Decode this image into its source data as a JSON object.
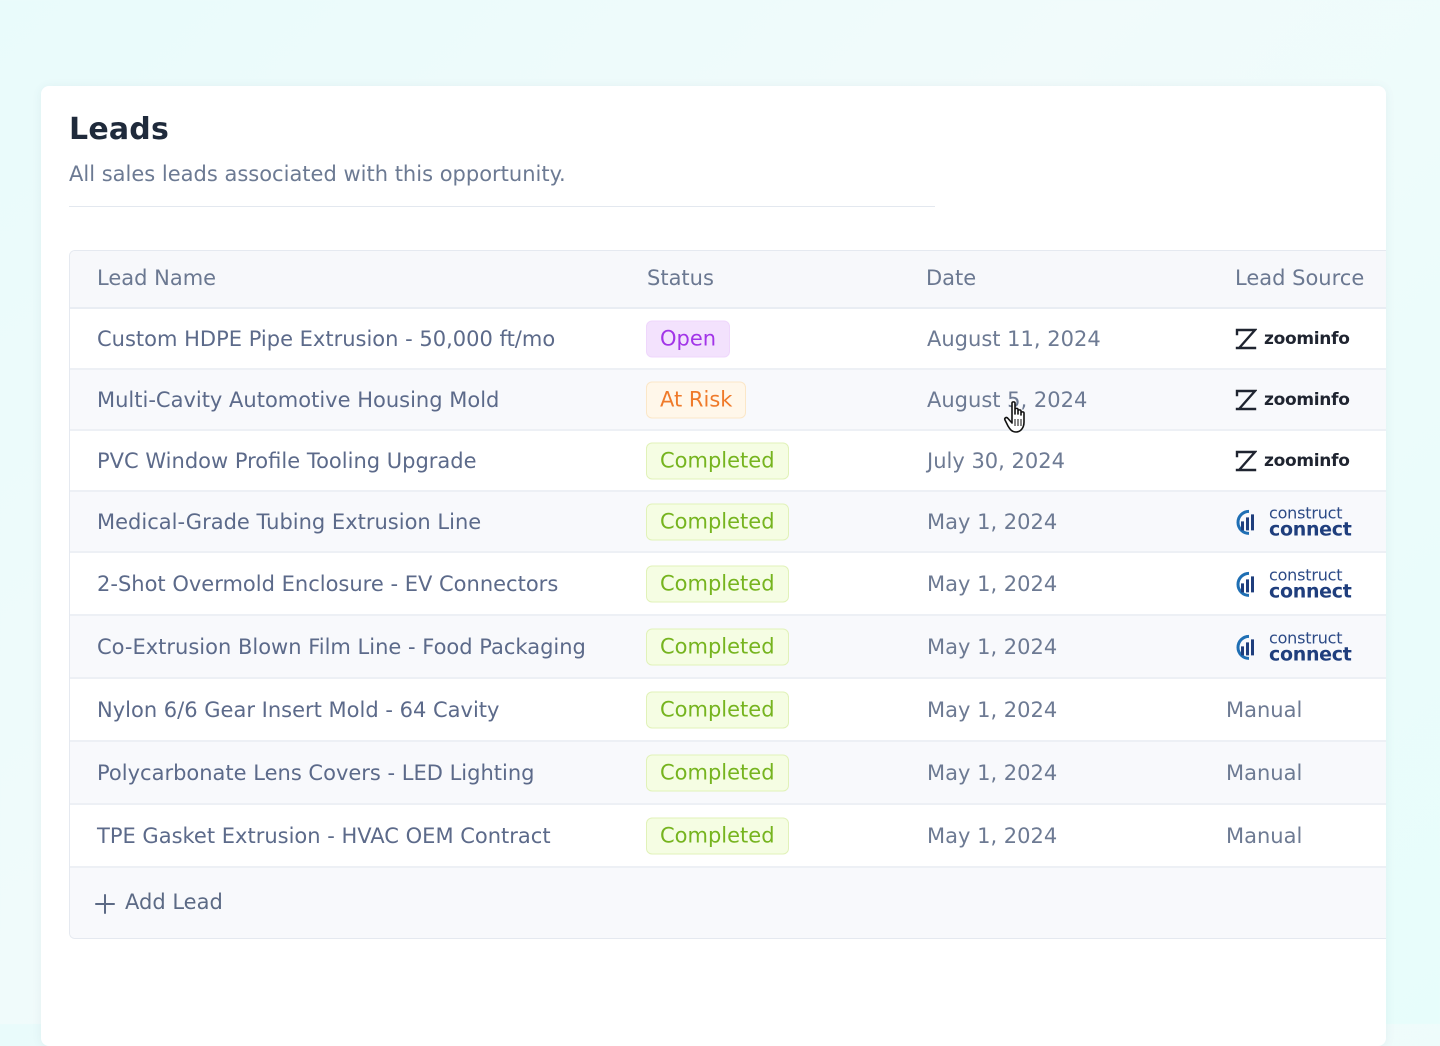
{
  "card": {
    "title": "Leads",
    "subtitle": "All sales leads associated with this opportunity."
  },
  "table": {
    "columns": [
      "Lead Name",
      "Status",
      "Date",
      "Lead Source"
    ],
    "rows": [
      {
        "name": "Custom HDPE Pipe Extrusion - 50,000 ft/mo",
        "status": "Open",
        "status_kind": "open",
        "date": "August 11, 2024",
        "source": "zoominfo",
        "source_kind": "zoominfo"
      },
      {
        "name": "Multi-Cavity Automotive Housing Mold",
        "status": "At Risk",
        "status_kind": "risk",
        "date": "August 5, 2024",
        "source": "zoominfo",
        "source_kind": "zoominfo"
      },
      {
        "name": "PVC Window Profile Tooling Upgrade",
        "status": "Completed",
        "status_kind": "done",
        "date": "July 30, 2024",
        "source": "zoominfo",
        "source_kind": "zoominfo"
      },
      {
        "name": "Medical-Grade Tubing Extrusion Line",
        "status": "Completed",
        "status_kind": "done",
        "date": "May 1, 2024",
        "source": "construct connect",
        "source_kind": "constructconnect"
      },
      {
        "name": "2-Shot Overmold Enclosure - EV Connectors",
        "status": "Completed",
        "status_kind": "done",
        "date": "May 1, 2024",
        "source": "construct connect",
        "source_kind": "constructconnect"
      },
      {
        "name": "Co-Extrusion Blown Film Line - Food Packaging",
        "status": "Completed",
        "status_kind": "done",
        "date": "May 1, 2024",
        "source": "construct connect",
        "source_kind": "constructconnect"
      },
      {
        "name": "Nylon 6/6 Gear Insert Mold - 64 Cavity",
        "status": "Completed",
        "status_kind": "done",
        "date": "May 1, 2024",
        "source": "Manual",
        "source_kind": "manual"
      },
      {
        "name": "Polycarbonate Lens Covers - LED Lighting",
        "status": "Completed",
        "status_kind": "done",
        "date": "May 1, 2024",
        "source": "Manual",
        "source_kind": "manual"
      },
      {
        "name": "TPE Gasket Extrusion - HVAC OEM Contract",
        "status": "Completed",
        "status_kind": "done",
        "date": "May 1, 2024",
        "source": "Manual",
        "source_kind": "manual"
      }
    ],
    "add_label": "Add Lead"
  },
  "logos": {
    "zoominfo": {
      "top": "",
      "label": "zoominfo"
    },
    "constructconnect": {
      "top": "construct",
      "label": "connect"
    }
  },
  "colors": {
    "status_open": "#a235e8",
    "status_risk": "#ef7a2a",
    "status_done": "#76b41f",
    "title": "#1f2a3b"
  }
}
